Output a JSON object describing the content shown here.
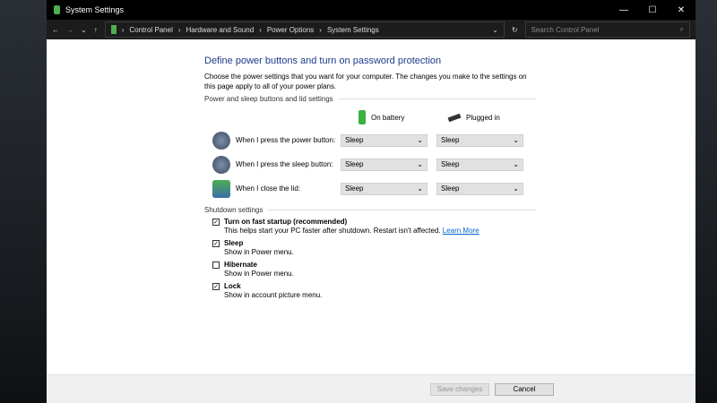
{
  "window": {
    "title": "System Settings"
  },
  "address": {
    "crumbs": [
      "Control Panel",
      "Hardware and Sound",
      "Power Options",
      "System Settings"
    ],
    "search_placeholder": "Search Control Panel"
  },
  "main": {
    "title": "Define power buttons and turn on password protection",
    "description": "Choose the power settings that you want for your computer. The changes you make to the settings on this page apply to all of your power plans.",
    "section1": "Power and sleep buttons and lid settings",
    "col_battery": "On battery",
    "col_plugged": "Plugged in",
    "rows": [
      {
        "label": "When I press the power button:",
        "battery": "Sleep",
        "plugged": "Sleep"
      },
      {
        "label": "When I press the sleep button:",
        "battery": "Sleep",
        "plugged": "Sleep"
      },
      {
        "label": "When I close the lid:",
        "battery": "Sleep",
        "plugged": "Sleep"
      }
    ],
    "section2": "Shutdown settings",
    "options": [
      {
        "label": "Turn on fast startup (recommended)",
        "sub": "This helps start your PC faster after shutdown. Restart isn't affected.",
        "link": "Learn More",
        "checked": true
      },
      {
        "label": "Sleep",
        "sub": "Show in Power menu.",
        "checked": true
      },
      {
        "label": "Hibernate",
        "sub": "Show in Power menu.",
        "checked": false
      },
      {
        "label": "Lock",
        "sub": "Show in account picture menu.",
        "checked": true
      }
    ]
  },
  "footer": {
    "save": "Save changes",
    "cancel": "Cancel"
  }
}
